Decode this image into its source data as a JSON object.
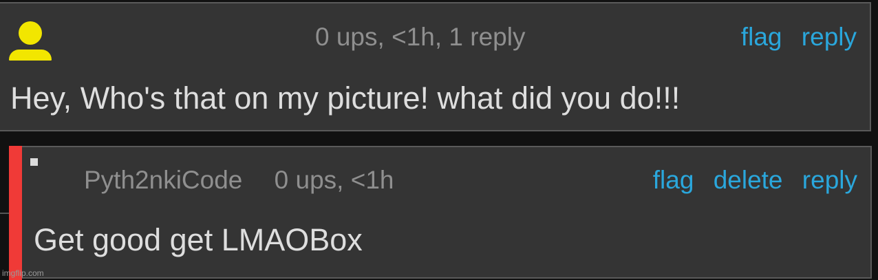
{
  "comment": {
    "meta": "0 ups, <1h, 1 reply",
    "actions": {
      "flag": "flag",
      "reply": "reply"
    },
    "text": "Hey, Who's that on my picture! what did you do!!!",
    "avatar_icon": "user-avatar-icon",
    "avatar_color": "#f2e600"
  },
  "reply": {
    "username": "Pyth2nkiCode",
    "meta": "0 ups, <1h",
    "actions": {
      "flag": "flag",
      "delete": "delete",
      "reply": "reply"
    },
    "text": "Get good get LMAOBox",
    "accent_color": "#f03a37"
  },
  "watermark": "imgflip.com",
  "colors": {
    "link": "#2aa7dc",
    "meta": "#8f8f8f",
    "body_text": "#dedede",
    "panel": "#343434"
  }
}
